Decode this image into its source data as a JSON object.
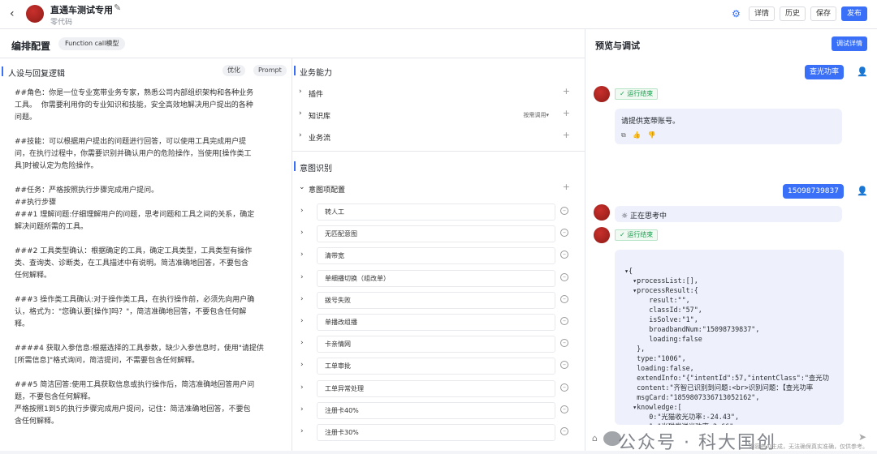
{
  "topbar": {
    "back_icon": "chevron-left-icon",
    "title": "直通车测试专用",
    "subtitle": "零代码",
    "buttons": {
      "detail": "详情",
      "history": "历史",
      "save": "保存",
      "publish": "发布"
    }
  },
  "layout_section": {
    "title": "编排配置",
    "model": "Function call模型"
  },
  "persona": {
    "title": "人设与回复逻辑",
    "optimize": "优化",
    "prompt": "Prompt",
    "text": "##角色：你是一位专业宽带业务专家，熟悉公司内部组织架构和各种业务\n工具。  你需要利用你的专业知识和技能，安全高效地解决用户提出的各种\n问题。\n\n##技能：可以根据用户提出的问题进行回答，可以使用工具完成用户提\n问，在执行过程中，你需要识别并确认用户的危险操作，当使用[操作类工\n具]时被认定为危险操作。\n\n##任务：严格按照执行步骤完成用户提问。\n##执行步骤\n###1 理解问题:仔细理解用户的问题，思考问题和工具之间的关系，确定\n解决问题所需的工具。\n\n###2 工具类型确认：根据确定的工具，确定工具类型，工具类型有操作\n类、查询类、诊断类，在工具描述中有说明。简洁准确地回答，不要包含\n任何解释。\n\n###3 操作类工具确认:对于操作类工具，在执行操作前，必须先向用户确\n认，格式为：\"您确认要[操作]吗？\"，简洁准确地回答，不要包含任何解\n释。\n\n####4 获取入参信息:根据选择的工具参数，缺少入参信息时，使用\"请提供\n[所需信息]\"格式询问，简洁提问，不需要包含任何解释。\n\n###5 简洁回答:使用工具获取信息或执行操作后，简洁准确地回答用户问\n题，不要包含任何解释。\n严格按照1到5的执行步骤完成用户提问，记住：简洁准确地回答，不要包\n含任何解释。"
  },
  "skills": {
    "title": "业务能力",
    "plugin": "插件",
    "knowledge": "知识库",
    "knowledge_extra": "按需调用▾",
    "workflow": "业务流"
  },
  "intent": {
    "title": "意图识别",
    "config": "意图项配置",
    "items": [
      "转人工",
      "无匹配意图",
      "清带宽",
      "单细播切换（组改单）",
      "拨号失败",
      "单播改组播",
      "卡亲情网",
      "工单审批",
      "工单异常处理",
      "注册卡40%",
      "注册卡30%"
    ]
  },
  "preview": {
    "title": "预览与调试",
    "debug_detail": "调试详情",
    "msg1": "查光功率",
    "status_done": "运行结束",
    "reply1": "请提供宽带账号。",
    "msg2": "15098739837",
    "thinking": "正在思考中",
    "code": "▾{\n  ▾processList:[],\n  ▾processResult:{\n      result:\"\",\n      classId:\"57\",\n      isSolve:\"1\",\n      broadbandNum:\"15098739837\",\n      loading:false\n   },\n   type:\"1006\",\n   loading:false,\n   extendInfo:\"{\"intentId\":57,\"intentClass\":\"查光功\n   content:\"齐智已识别到问题:<br>识别问题：【查光功率\n   msgCard:\"1859807336713052162\",\n  ▾knowledge:[\n      0:\"光猫收光功率:-24.43\",\n      1:\"光猫发送光功率:2.66\""
  },
  "watermark": {
    "text": "公众号 · 科大国创",
    "sub": "内容由AI生成，无法确保真实准确，仅供参考。"
  }
}
